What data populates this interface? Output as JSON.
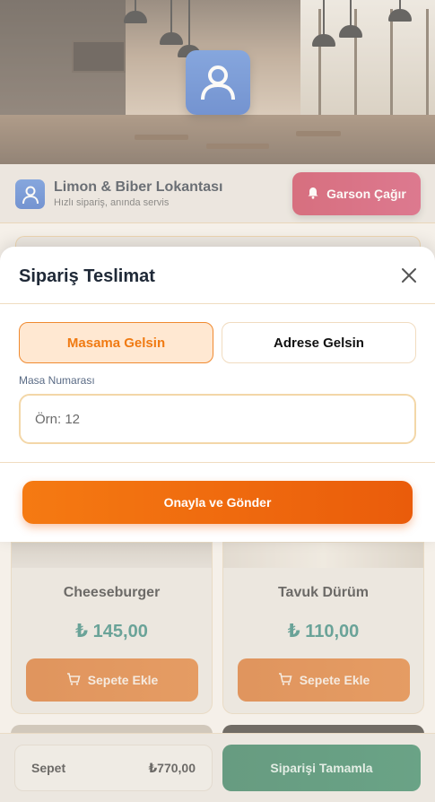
{
  "header": {
    "restaurant_name": "Limon & Biber Lokantası",
    "tagline": "Hızlı sipariş, anında servis",
    "call_waiter_label": "Garson Çağır",
    "icons": {
      "brand": "user-avatar-icon",
      "call_waiter": "bell-icon"
    }
  },
  "products": [
    {
      "name": "Cheeseburger",
      "price": "₺ 145,00",
      "add_label": "Sepete Ekle"
    },
    {
      "name": "Tavuk Dürüm",
      "price": "₺ 110,00",
      "add_label": "Sepete Ekle"
    }
  ],
  "cart": {
    "label": "Sepet",
    "total": "₺770,00",
    "checkout_label": "Siparişi Tamamla"
  },
  "modal": {
    "title": "Sipariş Teslimat",
    "options": [
      {
        "label": "Masama Gelsin",
        "selected": true
      },
      {
        "label": "Adrese Gelsin",
        "selected": false
      }
    ],
    "field_label": "Masa Numarası",
    "field_value": "",
    "field_placeholder": "Örn: 12",
    "confirm_label": "Onayla ve Gönder"
  },
  "colors": {
    "accent_orange": "#f07a12",
    "call_red": "#c62a47",
    "checkout_green": "#1b6e4a",
    "price_teal": "#207a6e",
    "brand_blue": "#2f62c4"
  }
}
